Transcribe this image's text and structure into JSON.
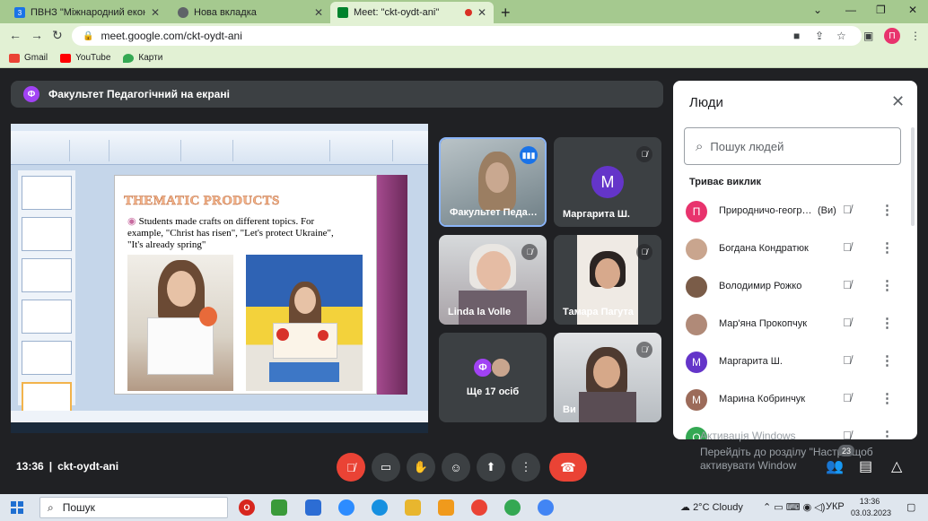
{
  "browser": {
    "tabs": [
      {
        "title": "ПВНЗ \"Міжнародний економіко",
        "favicon": "3",
        "favicon_color": "#1a73e8"
      },
      {
        "title": "Нова вкладка",
        "favicon": "",
        "favicon_color": "#5f6368"
      },
      {
        "title": "Meet: \"ckt-oydt-ani\"",
        "favicon": "",
        "favicon_color": "#00832d"
      }
    ],
    "url": "meet.google.com/ckt-oydt-ani",
    "profile_initial": "П",
    "bookmarks": [
      {
        "label": "Gmail",
        "color": "#ea4335"
      },
      {
        "label": "YouTube",
        "color": "#ff0000"
      },
      {
        "label": "Карти",
        "color": "#34a853"
      }
    ]
  },
  "meet": {
    "presenting": {
      "initial": "Ф",
      "text": "Факультет Педагогічний на екрані"
    },
    "slide": {
      "title": "THEMATIC PRODUCTS",
      "text": "Students made crafts on different topics. For example, \"Christ has risen\", \"Let's protect Ukraine\", \"It's already spring\""
    },
    "tiles": [
      {
        "name": "Факультет Педа…",
        "speaking": true
      },
      {
        "name": "Маргарита Ш.",
        "initial": "М"
      },
      {
        "name": "Linda la Volle"
      },
      {
        "name": "Тамара Пагута"
      },
      {
        "name": "Ще 17 осіб",
        "initial": "Ф"
      },
      {
        "name": "Ви"
      }
    ],
    "time": "13:36",
    "meeting_code": "ckt-oydt-ani",
    "people_count": "23"
  },
  "people": {
    "title": "Люди",
    "search_placeholder": "Пошук людей",
    "section": "Триває виклик",
    "you_label": "(Ви)",
    "list": [
      {
        "name": "Природничо-геогр…",
        "initial": "П",
        "color": "#e8336d",
        "you": true
      },
      {
        "name": "Богдана Кондратюк",
        "initial": "",
        "color": "#c9a58e"
      },
      {
        "name": "Володимир Рожко",
        "initial": "",
        "color": "#7a5c48"
      },
      {
        "name": "Мар'яна Прокопчук",
        "initial": "",
        "color": "#b08a78"
      },
      {
        "name": "Маргарита Ш.",
        "initial": "М",
        "color": "#6435c9"
      },
      {
        "name": "Марина Кобринчук",
        "initial": "М",
        "color": "#9c6b5a"
      },
      {
        "name": "",
        "initial": "О",
        "color": "#34a853"
      }
    ]
  },
  "windows": {
    "activate_line1": "Активація Windows",
    "activate_line2": "Перейдіть до розділу \"Настро",
    "activate_line2_end": "щоб",
    "activate_line3": "активувати Window",
    "search": "Пошук",
    "weather": "2°C Cloudy",
    "lang": "УКР",
    "clock_time": "13:36",
    "clock_date": "03.03.2023"
  }
}
